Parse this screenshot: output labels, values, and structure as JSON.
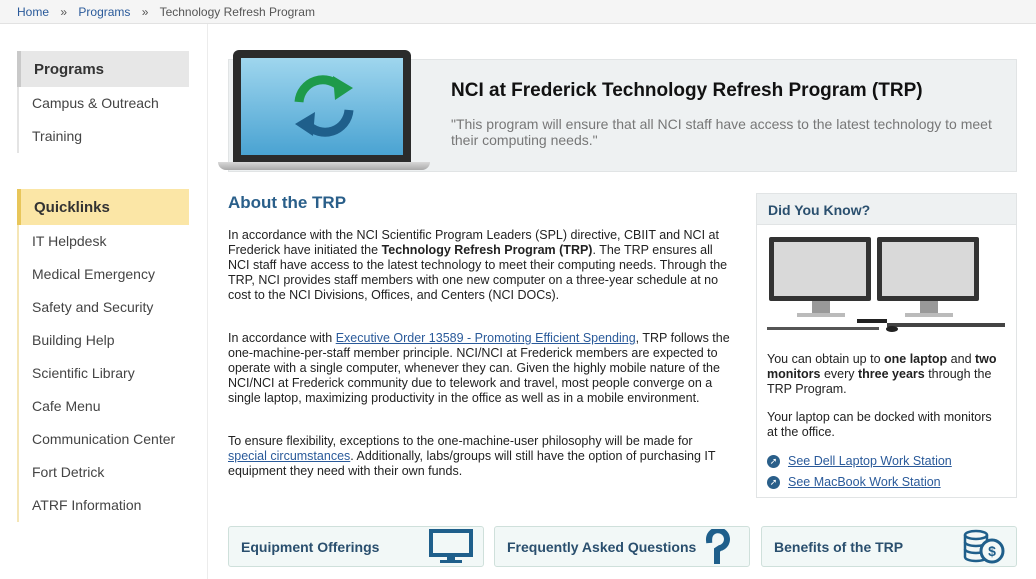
{
  "breadcrumb": {
    "home": "Home",
    "sep1": "»",
    "programs": "Programs",
    "sep2": "»",
    "current": "Technology Refresh Program"
  },
  "sidebar": {
    "programs_heading": "Programs",
    "programs_items": [
      "Campus & Outreach",
      "Training"
    ],
    "quicklinks_heading": "Quicklinks",
    "quicklinks_items": [
      "IT Helpdesk",
      "Medical Emergency",
      "Safety and Security",
      "Building Help",
      "Scientific Library",
      "Cafe Menu",
      "Communication Center",
      "Fort Detrick",
      "ATRF Information"
    ]
  },
  "hero": {
    "title": "NCI at Frederick Technology Refresh Program (TRP)",
    "quote": "\"This program will ensure that all NCI staff have access to the latest technology to meet their computing needs.\""
  },
  "about": {
    "title": "About the TRP",
    "p1_a": "In accordance with the NCI Scientific Program Leaders (SPL) directive, CBIIT and NCI at Frederick have initiated the ",
    "p1_bold": "Technology Refresh Program (TRP)",
    "p1_b": ". The TRP ensures all NCI staff have access to the latest technology to meet their computing needs. Through the TRP, NCI provides staff members with one new computer on a three-year schedule at no cost to the NCI Divisions, Offices, and Centers (NCI DOCs).",
    "p2_a": "In accordance with ",
    "p2_link": "Executive Order 13589 - Promoting Efficient Spending",
    "p2_b": ", TRP follows the one-machine-per-staff member principle. NCI/NCI at Frederick members are expected to operate with a single computer, whenever they can. Given the highly mobile nature of the NCI/NCI at Frederick community due to telework and travel, most people converge on a single laptop, maximizing productivity in the office as well as in a mobile environment.",
    "p3_a": "To ensure flexibility, exceptions to the one-machine-user philosophy will be made for ",
    "p3_link": "special circumstances",
    "p3_b": ". Additionally, labs/groups will still have the option of purchasing IT equipment they need with their own funds."
  },
  "did_you_know": {
    "heading": "Did You Know?",
    "t1_a": "You can obtain up to ",
    "t1_b1": "one laptop",
    "t1_c": " and ",
    "t1_b2": "two monitors",
    "t1_d": " every ",
    "t1_b3": "three years",
    "t1_e": " through the TRP Program.",
    "t2": "Your laptop can be docked with monitors at the office.",
    "link1": "See Dell Laptop Work Station",
    "link2": "See MacBook Work Station"
  },
  "cards": {
    "equipment": "Equipment Offerings",
    "faq": "Frequently Asked Questions",
    "benefits": "Benefits of the TRP"
  },
  "colors": {
    "accent": "#2a5f8a",
    "refresh_green": "#1e9a4a",
    "refresh_blue": "#1f5f8b",
    "quicklinks_bg": "#fbe6a6"
  },
  "icons": {
    "hero": "refresh-arrows-icon",
    "card1": "monitor-icon",
    "card2": "question-mark-icon",
    "card3": "coins-dollar-icon",
    "link": "arrow-circle-icon"
  }
}
